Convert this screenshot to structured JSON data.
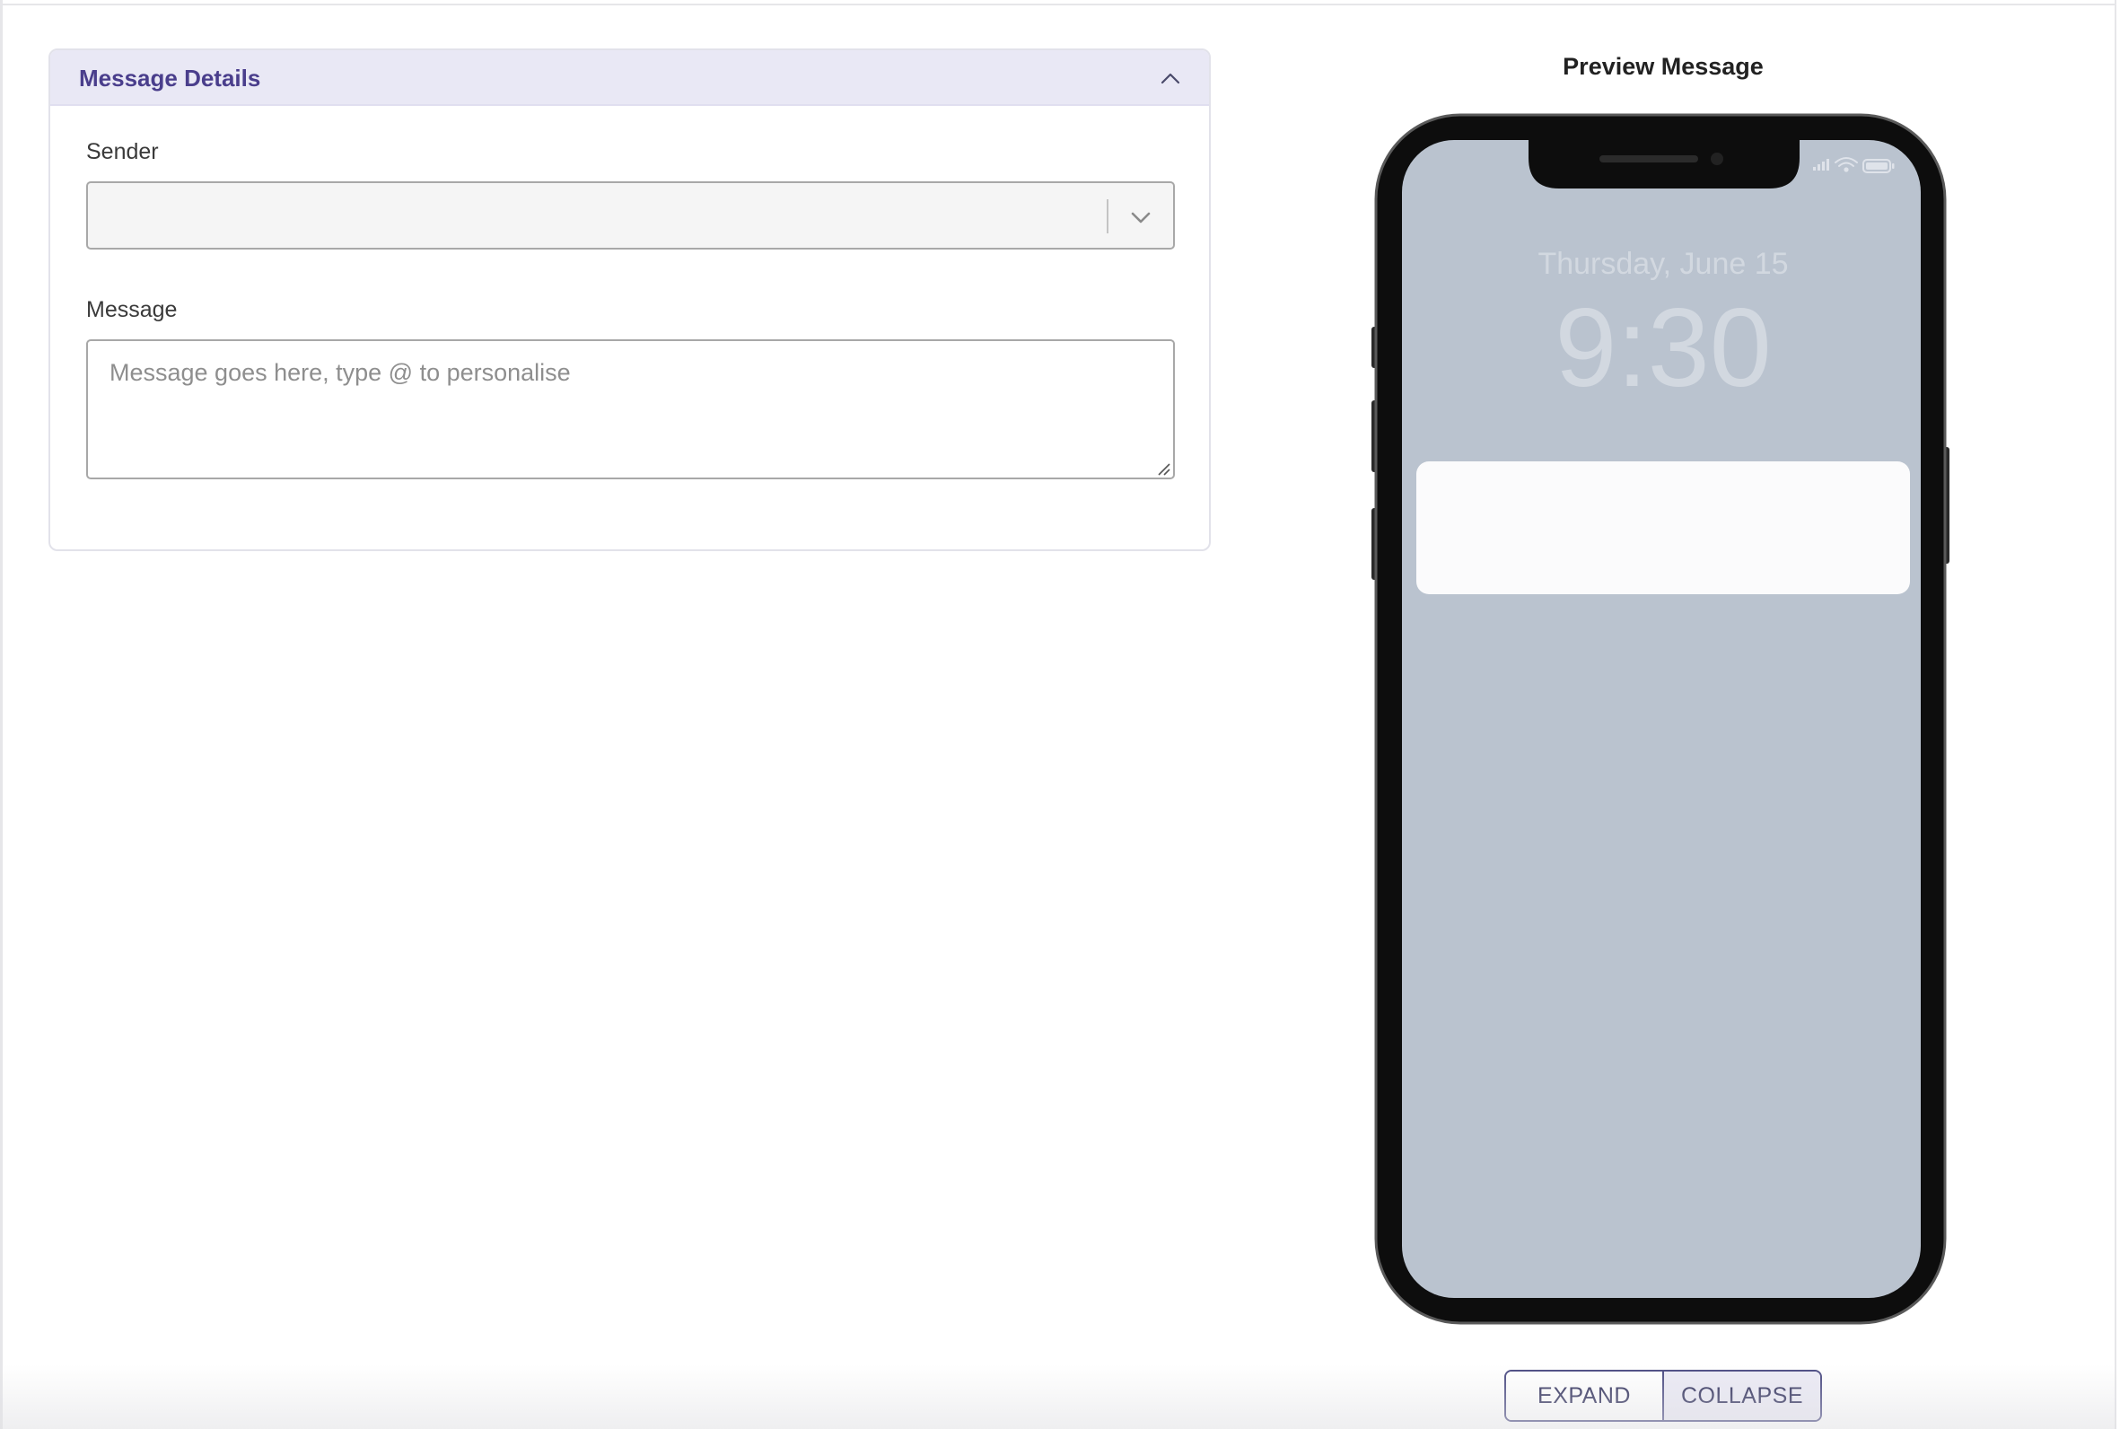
{
  "details_card": {
    "title": "Message Details",
    "collapse_icon": "chevron-up-icon",
    "sender": {
      "label": "Sender",
      "value": "",
      "dropdown_icon": "chevron-down-icon"
    },
    "message": {
      "label": "Message",
      "value": "",
      "placeholder": "Message goes here, type @ to personalise"
    }
  },
  "preview": {
    "title": "Preview Message",
    "lock_screen": {
      "date": "Thursday, June 15",
      "time": "9:30",
      "status_icons": [
        "signal-icon",
        "wifi-icon",
        "battery-icon"
      ]
    },
    "notification_text": ""
  },
  "view_toggle": {
    "expand_label": "EXPAND",
    "collapse_label": "COLLAPSE",
    "selected": "COLLAPSE"
  },
  "colors": {
    "card_header_bg": "#e9e8f5",
    "card_title": "#4a3e8c",
    "phone_screen": "#bac3cf",
    "phone_frame": "#0d0d0d",
    "toggle_border": "#4a4a82",
    "toggle_selected_bg": "#ebeaf5"
  }
}
